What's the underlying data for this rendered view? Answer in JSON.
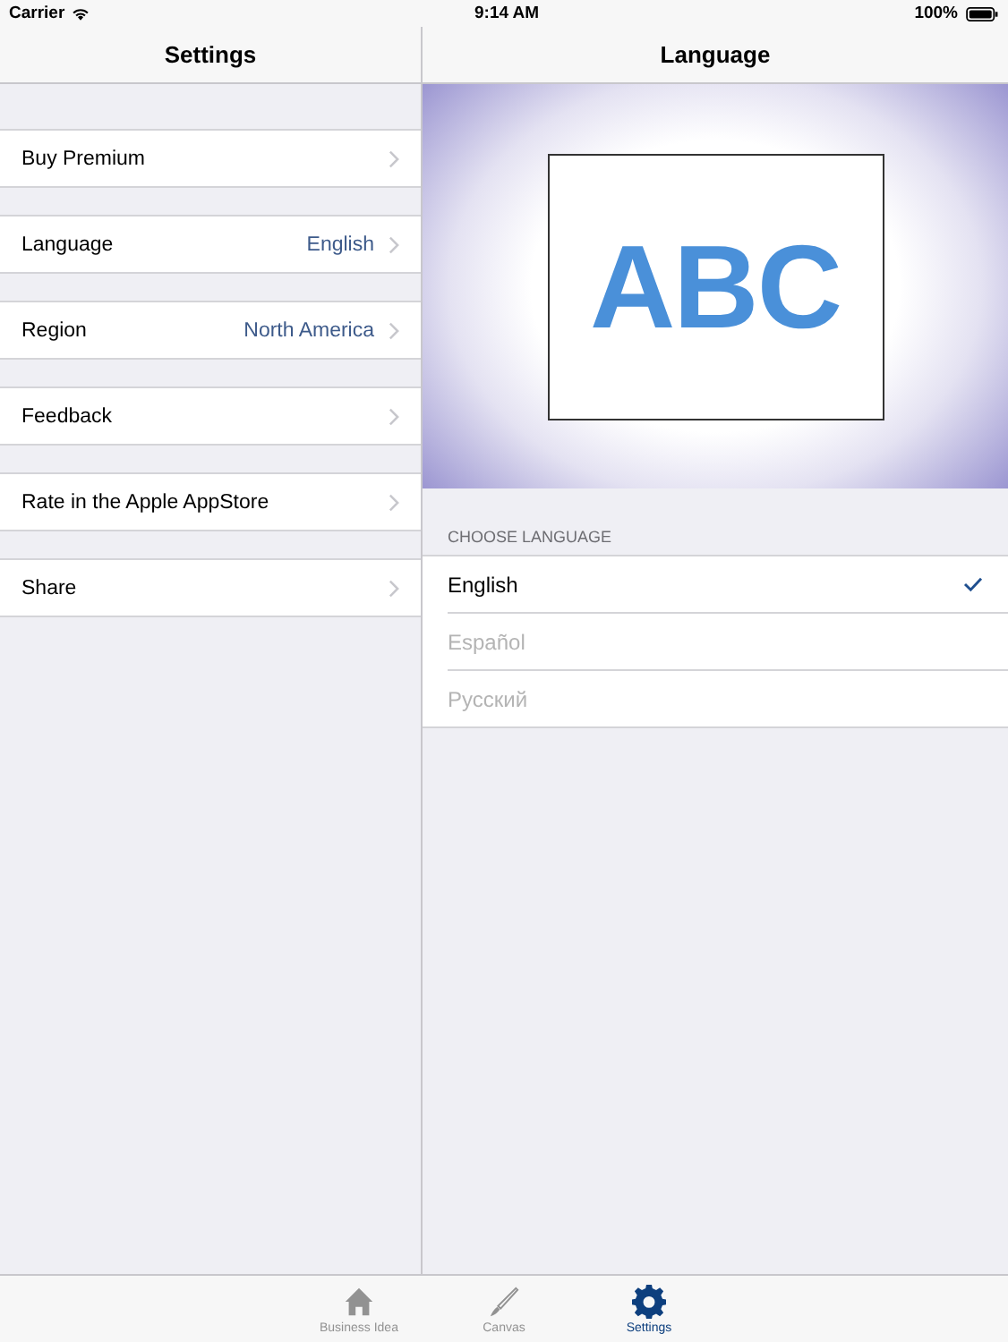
{
  "status_bar": {
    "carrier": "Carrier",
    "time": "9:14 AM",
    "battery": "100%"
  },
  "master": {
    "title": "Settings",
    "items": [
      {
        "label": "Buy Premium"
      },
      {
        "label": "Language",
        "value": "English"
      },
      {
        "label": "Region",
        "value": "North America"
      },
      {
        "label": "Feedback"
      },
      {
        "label": "Rate in the Apple AppStore"
      },
      {
        "label": "Share"
      }
    ]
  },
  "detail": {
    "title": "Language",
    "preview_text": "ABC",
    "section_header": "CHOOSE LANGUAGE",
    "languages": [
      {
        "label": "English",
        "selected": true
      },
      {
        "label": "Español",
        "selected": false
      },
      {
        "label": "Русский",
        "selected": false
      }
    ]
  },
  "tab_bar": [
    {
      "label": "Business Idea",
      "selected": false
    },
    {
      "label": "Canvas",
      "selected": false
    },
    {
      "label": "Settings",
      "selected": true
    }
  ]
}
